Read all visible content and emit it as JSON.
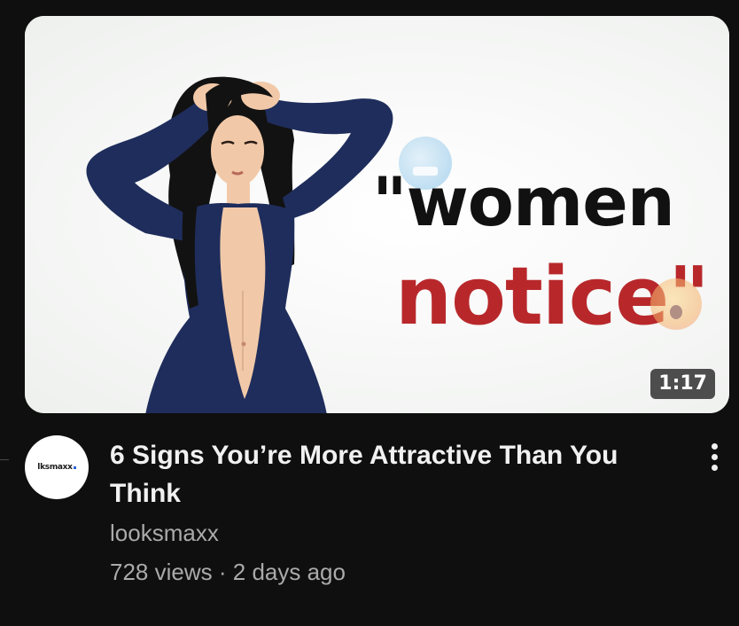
{
  "video": {
    "duration": "1:17",
    "title": "6 Signs You’re More Attractive Than You Think",
    "channel": "looksmaxx",
    "views": "728 views",
    "separator": "·",
    "age": "2 days ago"
  },
  "thumbnail": {
    "text_line1": "\"women",
    "text_line2": "notice\"",
    "colors": {
      "line1": "#111111",
      "line2": "#b8282b",
      "dress": "#1f2d5c",
      "hair": "#111111",
      "skin": "#f2c9a8"
    }
  },
  "avatar": {
    "text": "lksmaxx",
    "accent": "#2d63d9"
  },
  "icons": {
    "menu": "more-vertical-icon",
    "emoji_left": "cold-face-emoji-icon",
    "emoji_right": "anxious-sweat-emoji-icon"
  }
}
